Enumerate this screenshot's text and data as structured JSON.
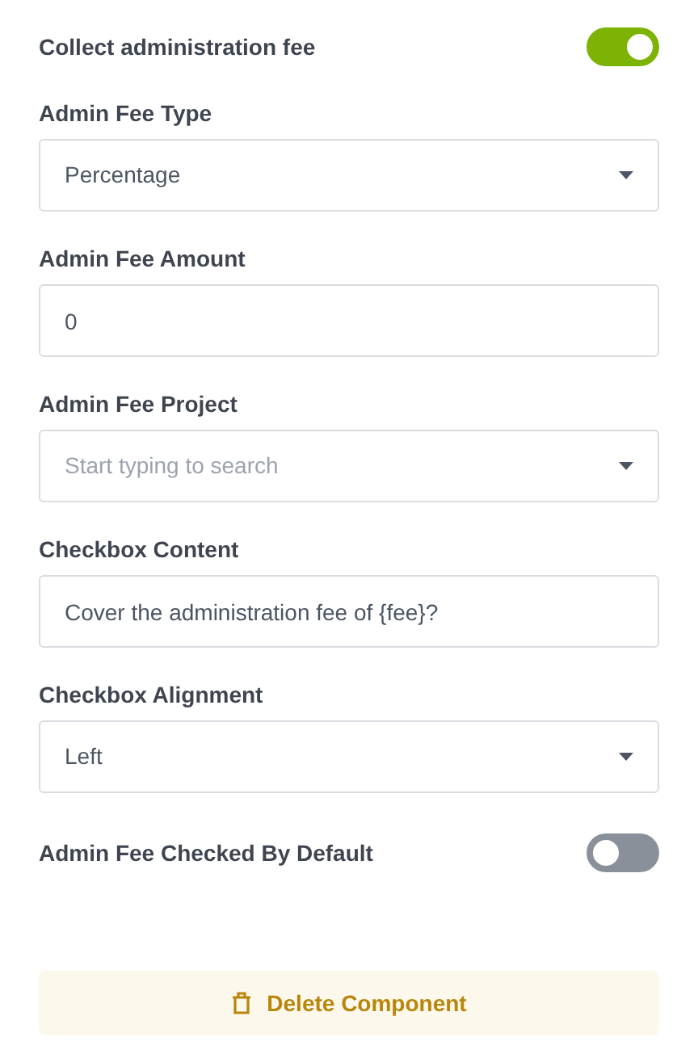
{
  "fields": [
    {
      "kind": "toggle",
      "label": "Collect administration fee",
      "on": true
    },
    {
      "kind": "select",
      "label": "Admin Fee Type",
      "value": "Percentage"
    },
    {
      "kind": "input",
      "label": "Admin Fee Amount",
      "value": "0"
    },
    {
      "kind": "select",
      "label": "Admin Fee Project",
      "placeholder": "Start typing to search"
    },
    {
      "kind": "input",
      "label": "Checkbox Content",
      "value": "Cover the administration fee of {fee}?"
    },
    {
      "kind": "select",
      "label": "Checkbox Alignment",
      "value": "Left"
    },
    {
      "kind": "toggle",
      "label": "Admin Fee Checked By Default",
      "on": false
    }
  ],
  "delete_button": {
    "label": "Delete Component"
  }
}
